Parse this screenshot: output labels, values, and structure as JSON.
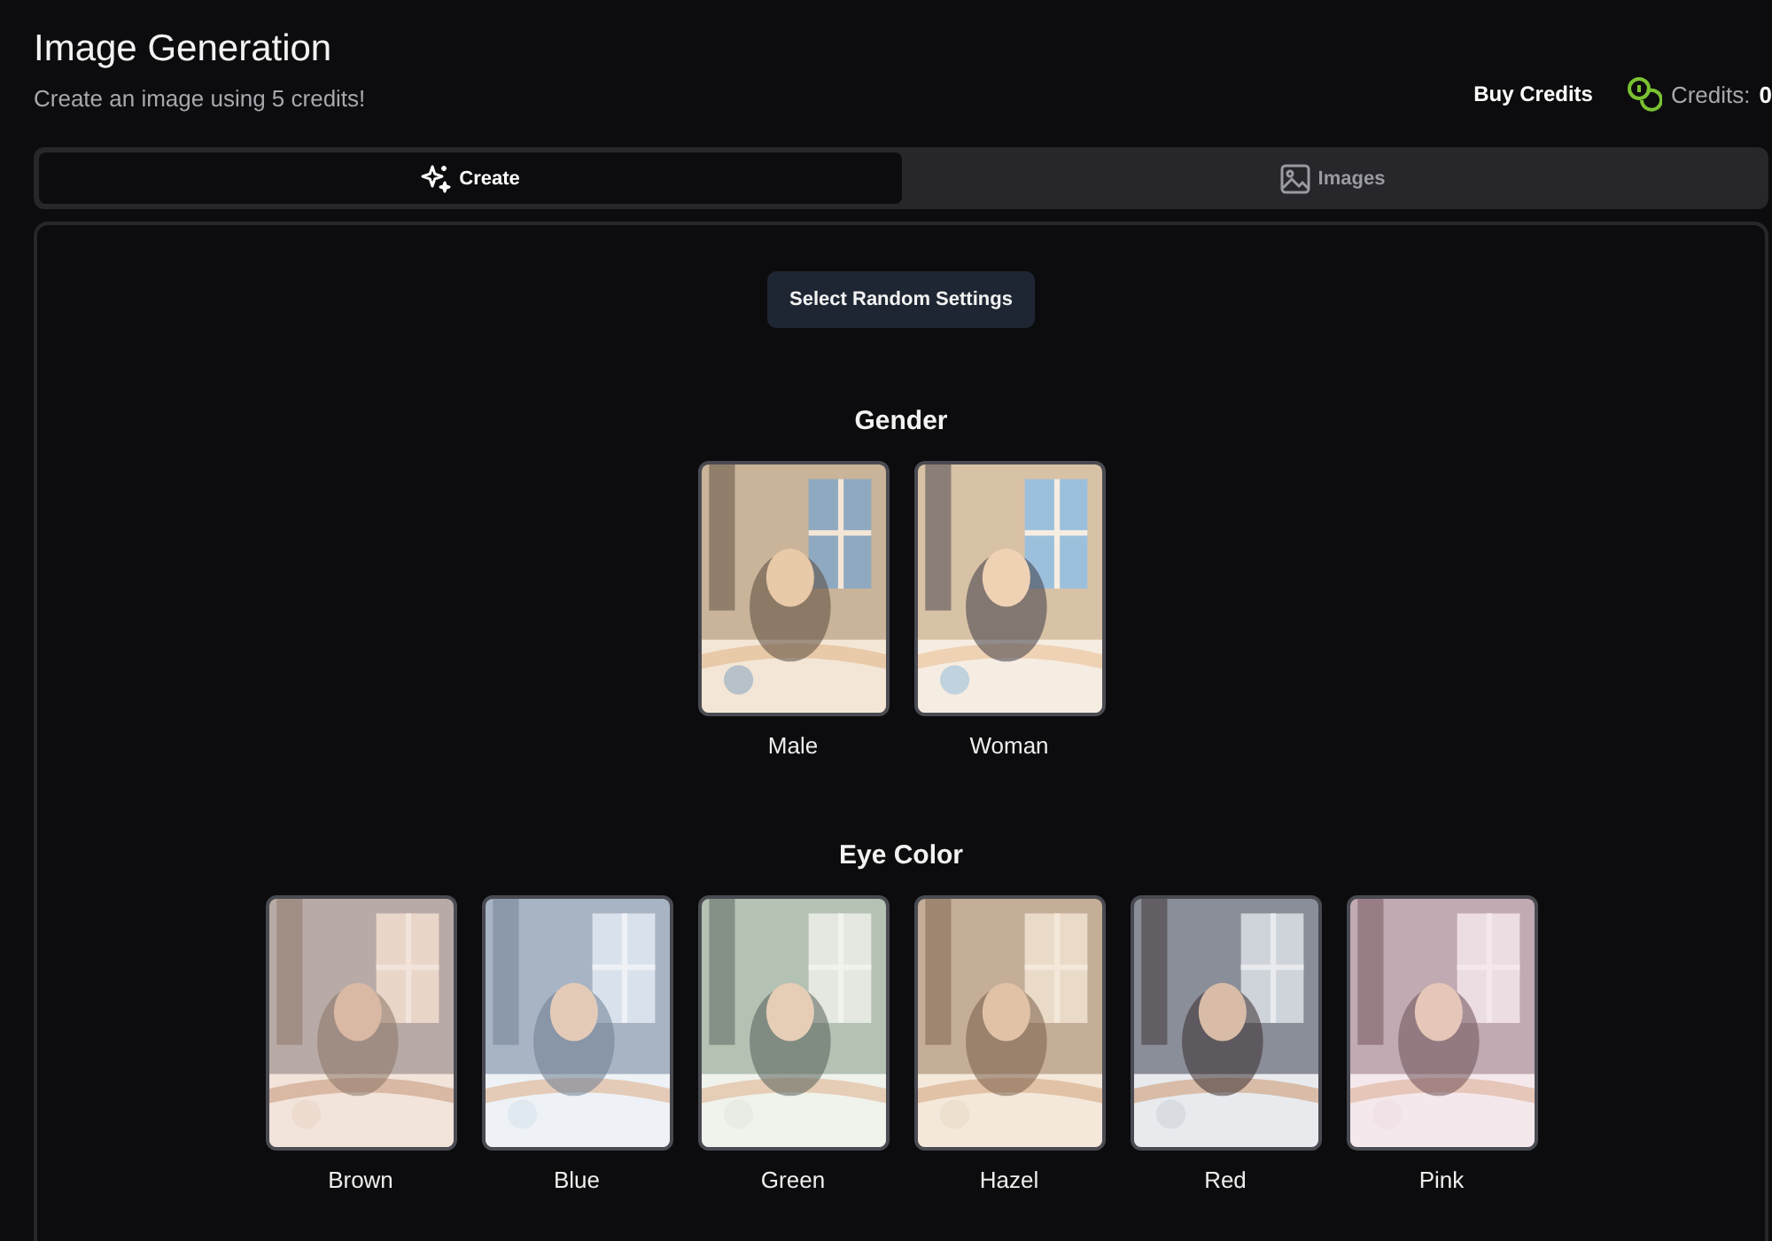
{
  "header": {
    "title": "Image Generation",
    "subtitle": "Create an image using 5 credits!",
    "buy_credits": "Buy Credits",
    "credits": "Credits:",
    "credits_value": "0"
  },
  "tabs": [
    {
      "label": "Create",
      "selected": true
    },
    {
      "label": "Images",
      "selected": false
    }
  ],
  "random_button": "Select Random Settings",
  "sections": [
    {
      "title": "Gender",
      "options": [
        {
          "label": "Male",
          "kind": "picture"
        },
        {
          "label": "Woman",
          "kind": "picture"
        }
      ]
    },
    {
      "title": "Eye Color",
      "options": [
        {
          "label": "Brown",
          "kind": "picture"
        },
        {
          "label": "Blue",
          "kind": "picture"
        },
        {
          "label": "Green",
          "kind": "picture"
        },
        {
          "label": "Hazel",
          "kind": "picture"
        },
        {
          "label": "Red",
          "kind": "picture"
        },
        {
          "label": "Pink",
          "kind": "picture"
        }
      ]
    }
  ]
}
